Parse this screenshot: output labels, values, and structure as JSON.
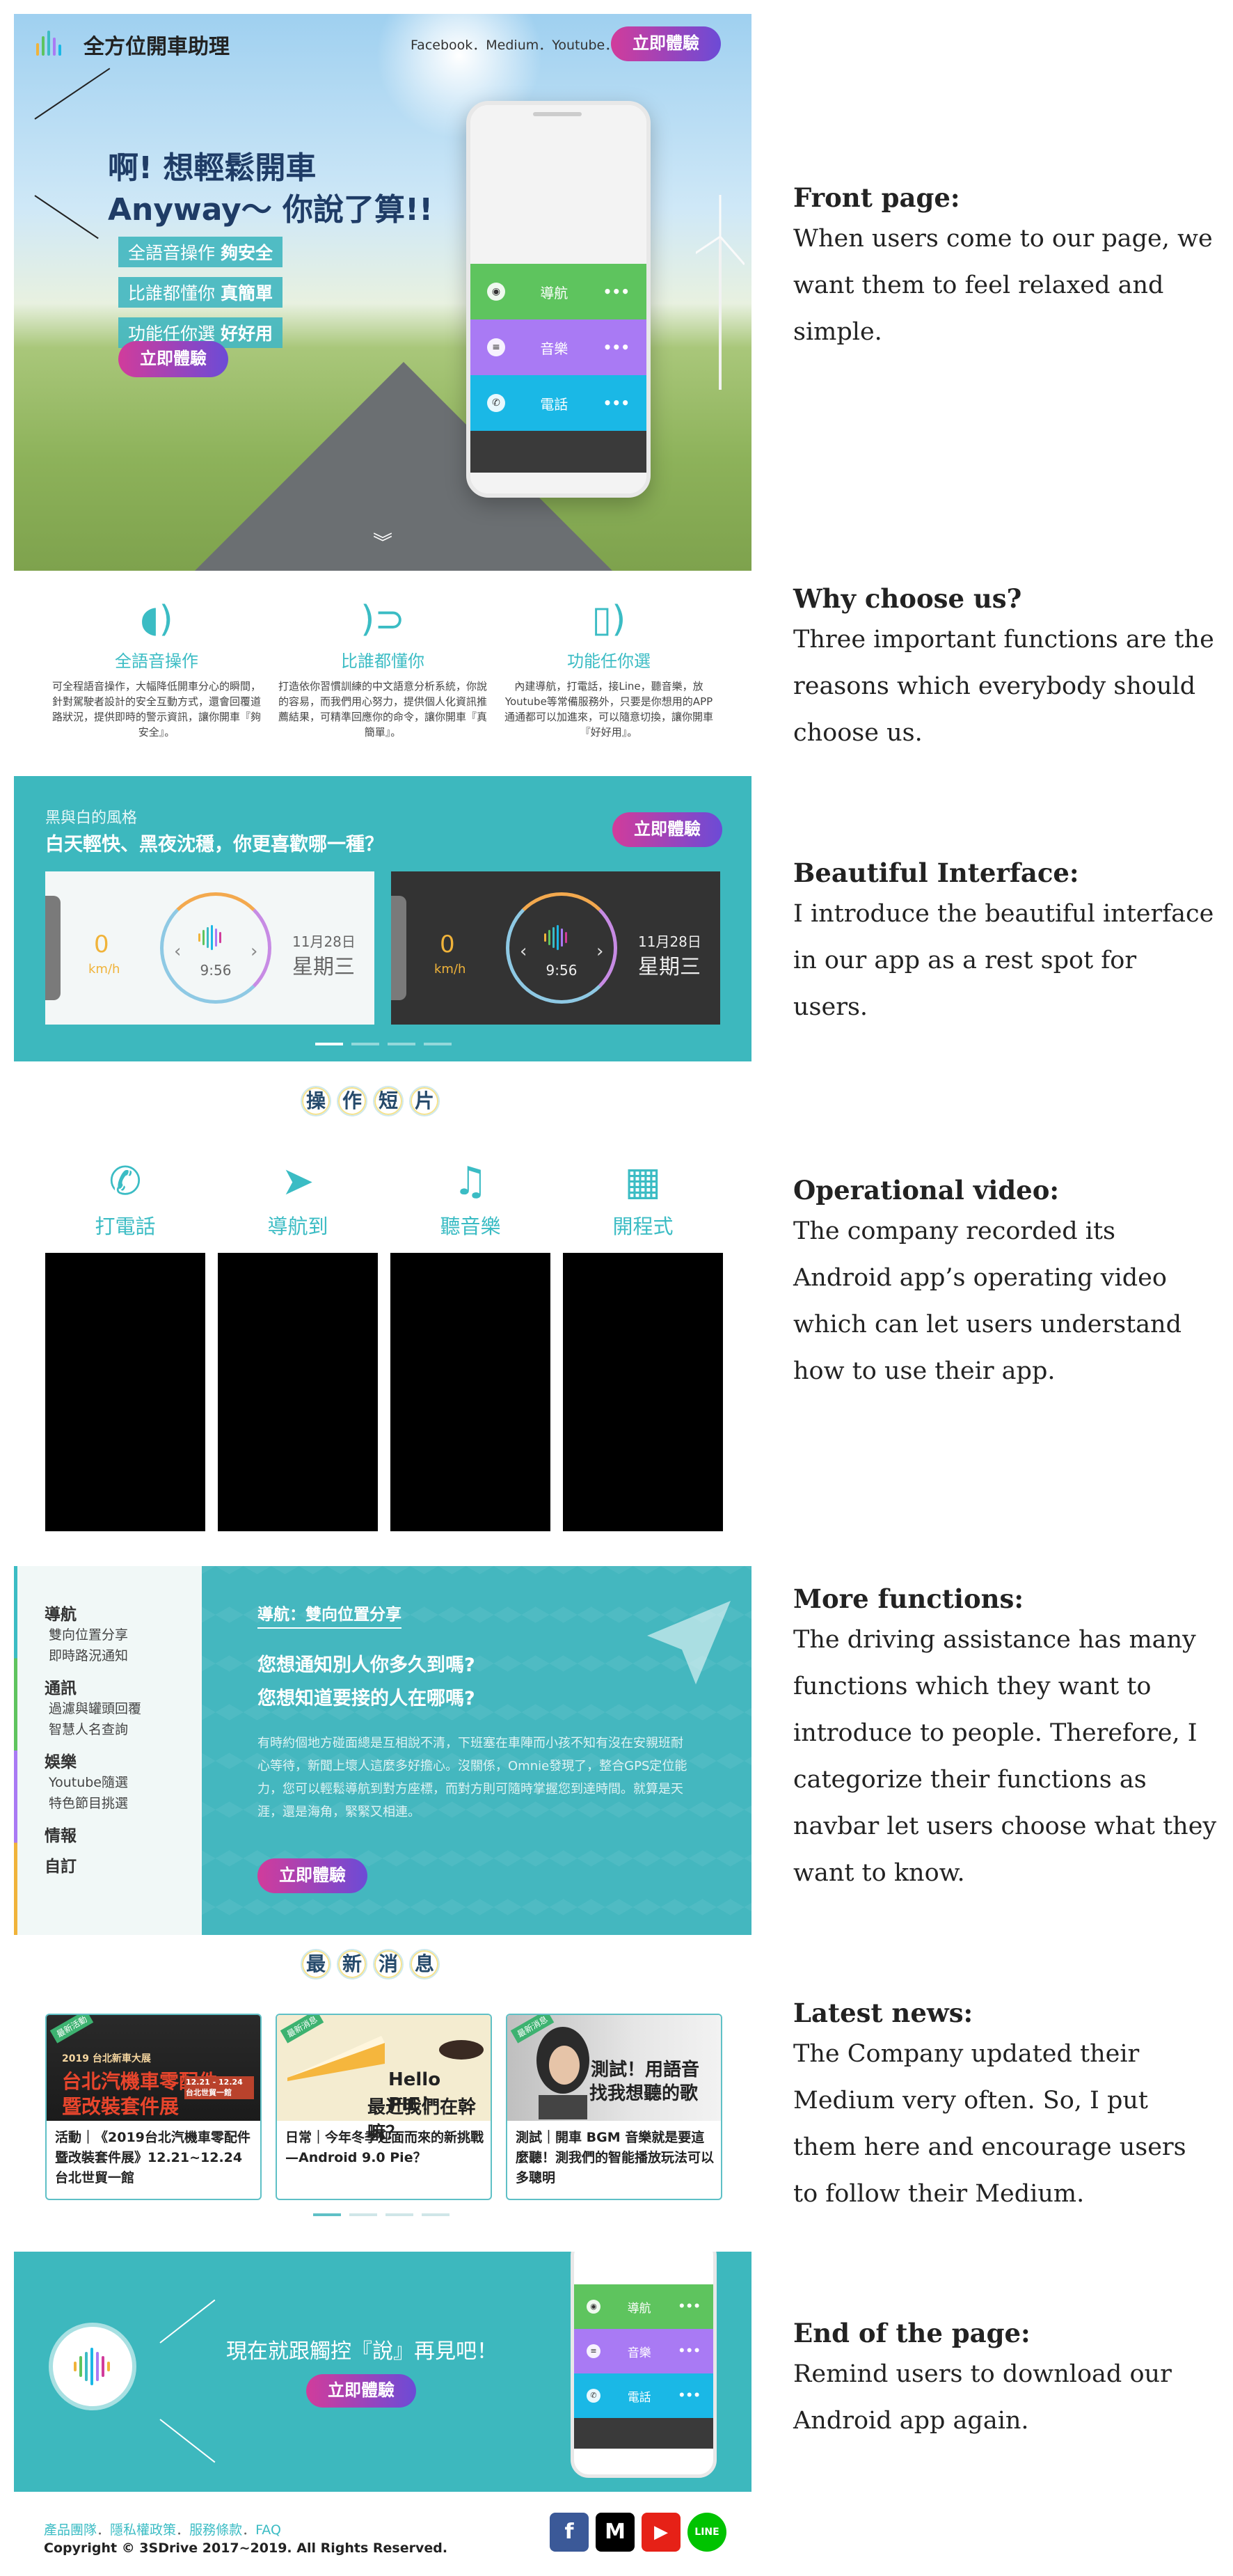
{
  "hero": {
    "brand": "全方位開車助理",
    "nav_links": "Facebook．Medium．Youtube．",
    "cta": "立即體驗",
    "title_line1": "啊! 想輕鬆開車",
    "title_line2": "Anyway～ 你說了算!!",
    "tags": [
      {
        "plain": "全語音操作 ",
        "bold": "夠安全"
      },
      {
        "plain": "比誰都懂你 ",
        "bold": "真簡單"
      },
      {
        "plain": "功能任你選 ",
        "bold": "好好用"
      }
    ],
    "hero_cta": "立即體驗",
    "scroll_icon": "chevron-double-down-icon",
    "phone": {
      "items": [
        "導航",
        "音樂",
        "電話"
      ],
      "more": "•••"
    }
  },
  "features": [
    {
      "icon": "voice-user-icon",
      "title": "全語音操作",
      "desc": "可全程語音操作，大幅降低開車分心的瞬間，針對駕駛者設計的安全互動方式，還會回覆道路狀況，提供即時的警示資訊，讓你開車『夠安全』。"
    },
    {
      "icon": "hearing-icon",
      "title": "比誰都懂你",
      "desc": "打造依你習慣訓練的中文語意分析系統，你說的容易，而我們用心努力，提供個人化資訊推薦結果，可精準回應你的命令，讓你開車『真簡單』。"
    },
    {
      "icon": "phone-vibrate-icon",
      "title": "功能任你選",
      "desc": "內建導航，打電話，接Line，聽音樂，放Youtube等常備服務外，只要是你想用的APP通通都可以加進來，可以隨意切換，讓你開車『好好用』。"
    }
  ],
  "interface": {
    "subtitle": "黑與白的風格",
    "title": "白天輕快、黑夜沈穩，你更喜歡哪一種？",
    "cta": "立即體驗",
    "cards": [
      {
        "theme": "light",
        "speed": "0",
        "unit": "km/h",
        "time": "9:56",
        "date": "11月28日",
        "weekday": "星期三"
      },
      {
        "theme": "dark",
        "speed": "0",
        "unit": "km/h",
        "time": "9:56",
        "date": "11月28日",
        "weekday": "星期三"
      }
    ]
  },
  "videos": {
    "title_chars": [
      "操",
      "作",
      "短",
      "片"
    ],
    "tabs": [
      {
        "icon": "phone-icon",
        "label": "打電話"
      },
      {
        "icon": "navigation-arrow-icon",
        "label": "導航到"
      },
      {
        "icon": "music-note-icon",
        "label": "聽音樂"
      },
      {
        "icon": "apps-grid-icon",
        "label": "開程式"
      }
    ]
  },
  "more": {
    "groups": [
      {
        "label": "導航",
        "items": [
          "雙向位置分享",
          "即時路況通知"
        ]
      },
      {
        "label": "通訊",
        "items": [
          "過濾與罐頭回覆",
          "智慧人名查詢"
        ]
      },
      {
        "label": "娛樂",
        "items": [
          "Youtube隨選",
          "特色節目挑選"
        ]
      },
      {
        "label": "情報",
        "items": []
      },
      {
        "label": "自訂",
        "items": []
      }
    ],
    "heading": "導航：雙向位置分享",
    "q1": "您想通知別人你多久到嗎?",
    "q2": "您想知道要接的人在哪嗎?",
    "paragraph": "有時約個地方碰面總是互相說不清，下班塞在車陣而小孩不知有沒在安親班耐心等待，新聞上壞人這麼多好擔心。沒關係，Omnie發現了，整合GPS定位能力，您可以輕鬆導航到對方座標，而對方則可隨時掌握您到達時間。就算是天涯，還是海角，緊緊又相連。",
    "cta": "立即體驗"
  },
  "news": {
    "title_chars": [
      "最",
      "新",
      "消",
      "息"
    ],
    "items": [
      {
        "badge": "最新活動",
        "img_line1": "2019 台北新車大展",
        "img_line2": "台北汽機車零配件",
        "img_line3": "暨改裝套件展",
        "img_side": "12.21 - 12.24 台北世貿一館",
        "caption": "活動｜《2019台北汽機車零配件暨改裝套件展》12.21~12.24 台北世貿一館"
      },
      {
        "badge": "最新消息",
        "img_line1": "Hello PIE！",
        "img_line2": "最近我們在幹嘛？",
        "caption": "日常｜今年冬季迎面而來的新挑戰—Android 9.0 Pie？"
      },
      {
        "badge": "最新消息",
        "img_line1": "測試！用語音",
        "img_line2": "找我想聽的歌",
        "caption": "測試｜開車 BGM 音樂就是要這麼聽！測我們的智能播放玩法可以多聰明"
      }
    ]
  },
  "endsec": {
    "message": "現在就跟觸控『說』再見吧！",
    "cta": "立即體驗",
    "phone_items": [
      "導航",
      "音樂",
      "電話"
    ],
    "more": "•••"
  },
  "footer": {
    "links": [
      "產品團隊",
      "隱私權政策",
      "服務條款",
      "FAQ"
    ],
    "sep": "．",
    "copyright": "Copyright © 3SDrive 2017~2019. All Rights Reserved.",
    "social": [
      {
        "name": "facebook-icon",
        "glyph": "f",
        "color": "#3b5998"
      },
      {
        "name": "medium-icon",
        "glyph": "M",
        "color": "#000000"
      },
      {
        "name": "youtube-icon",
        "glyph": "▶",
        "color": "#e62117"
      },
      {
        "name": "line-icon",
        "glyph": "LINE",
        "color": "#00c300"
      }
    ]
  },
  "notes": [
    {
      "heading": "Front page:",
      "body": "When users come to our page, we want them to feel relaxed and simple."
    },
    {
      "heading": "Why choose us?",
      "body": "Three important functions are the reasons which everybody should choose us."
    },
    {
      "heading": "Beautiful Interface:",
      "body": "I introduce the beautiful interface in our app as a rest spot for users."
    },
    {
      "heading": "Operational video:",
      "body": "The company recorded its Android app’s operating video which can let users understand how to use their app."
    },
    {
      "heading": "More functions:",
      "body": "The driving assistance has many functions which they want to introduce to people. Therefore, I categorize their functions as navbar let users choose what they want to know."
    },
    {
      "heading": "Latest news:",
      "body": "The Company updated their Medium very often. So, I put them here and encourage users to follow their Medium."
    },
    {
      "heading": "End of the page:",
      "body": "Remind users to download our Android app again."
    }
  ],
  "colors": {
    "teal": "#3db8be",
    "cta_start": "#d13c9b",
    "cta_end": "#6c4bd6",
    "nav_green": "#5ec45e",
    "music_purple": "#a97af4",
    "phone_blue": "#1ab8e6"
  }
}
